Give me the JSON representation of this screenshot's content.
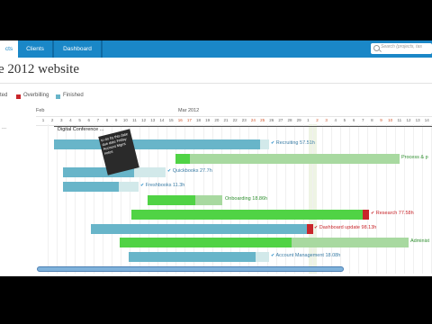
{
  "nav": {
    "tabs": [
      {
        "label": "cts",
        "active": true
      },
      {
        "label": "Clients",
        "active": false
      },
      {
        "label": "Dashboard",
        "active": false
      }
    ],
    "search_placeholder": "Search (projects, tas"
  },
  "page_title": "e 2012 website",
  "legend": [
    {
      "label": "ted",
      "color": "#50d345"
    },
    {
      "label": "Overbilling",
      "color": "#c8262b"
    },
    {
      "label": "Finished",
      "color": "#68b5c9"
    }
  ],
  "timeline": {
    "months": [
      {
        "label": "Feb"
      },
      {
        "label": "Mar 2012"
      }
    ],
    "days": [
      {
        "label": "1",
        "we": false
      },
      {
        "label": "2",
        "we": false
      },
      {
        "label": "3",
        "we": false
      },
      {
        "label": "4",
        "we": false
      },
      {
        "label": "5",
        "we": false
      },
      {
        "label": "6",
        "we": false
      },
      {
        "label": "7",
        "we": false
      },
      {
        "label": "8",
        "we": false
      },
      {
        "label": "9",
        "we": false
      },
      {
        "label": "10",
        "we": false
      },
      {
        "label": "11",
        "we": false
      },
      {
        "label": "12",
        "we": false
      },
      {
        "label": "13",
        "we": false
      },
      {
        "label": "14",
        "we": false
      },
      {
        "label": "15",
        "we": false
      },
      {
        "label": "16",
        "we": true
      },
      {
        "label": "17",
        "we": true
      },
      {
        "label": "18",
        "we": false
      },
      {
        "label": "19",
        "we": false
      },
      {
        "label": "20",
        "we": false
      },
      {
        "label": "21",
        "we": false
      },
      {
        "label": "22",
        "we": false
      },
      {
        "label": "23",
        "we": false
      },
      {
        "label": "24",
        "we": true
      },
      {
        "label": "25",
        "we": true
      },
      {
        "label": "26",
        "we": false
      },
      {
        "label": "27",
        "we": false
      },
      {
        "label": "28",
        "we": false
      },
      {
        "label": "29",
        "we": false
      },
      {
        "label": "1",
        "we": false
      },
      {
        "label": "2",
        "we": true
      },
      {
        "label": "3",
        "we": true
      },
      {
        "label": "4",
        "we": false
      },
      {
        "label": "5",
        "we": false
      },
      {
        "label": "6",
        "we": false
      },
      {
        "label": "7",
        "we": false
      },
      {
        "label": "8",
        "we": false
      },
      {
        "label": "9",
        "we": true
      },
      {
        "label": "10",
        "we": true
      },
      {
        "label": "11",
        "we": false
      },
      {
        "label": "12",
        "we": false
      },
      {
        "label": "13",
        "we": false
      },
      {
        "label": "14",
        "we": false
      }
    ]
  },
  "group_label": "Digital Conference ...",
  "tasks": [
    {
      "label": "Recruiting 57.51h",
      "label_color": "#3a7ca5"
    },
    {
      "label": "Process & p",
      "label_color": "#2f8f2f"
    },
    {
      "label": "Quickbooks 27.7h",
      "label_color": "#3a7ca5"
    },
    {
      "label": "Freshbooks 11.3h",
      "label_color": "#3a7ca5"
    },
    {
      "label": "Onboarding 18.86h",
      "label_color": "#2f8f2f"
    },
    {
      "label": "Research 77.58h",
      "label_color": "#c8262b"
    },
    {
      "label": "Dashboard update 98.13h",
      "label_color": "#c8262b"
    },
    {
      "label": "Administ",
      "label_color": "#2f8f2f"
    },
    {
      "label": "Account Management 18.08h",
      "label_color": "#3a7ca5"
    }
  ],
  "tooltip_lines": [
    "to do by this date",
    "due date Friday",
    "Account Mgmt notes"
  ],
  "menu_dots": "..."
}
